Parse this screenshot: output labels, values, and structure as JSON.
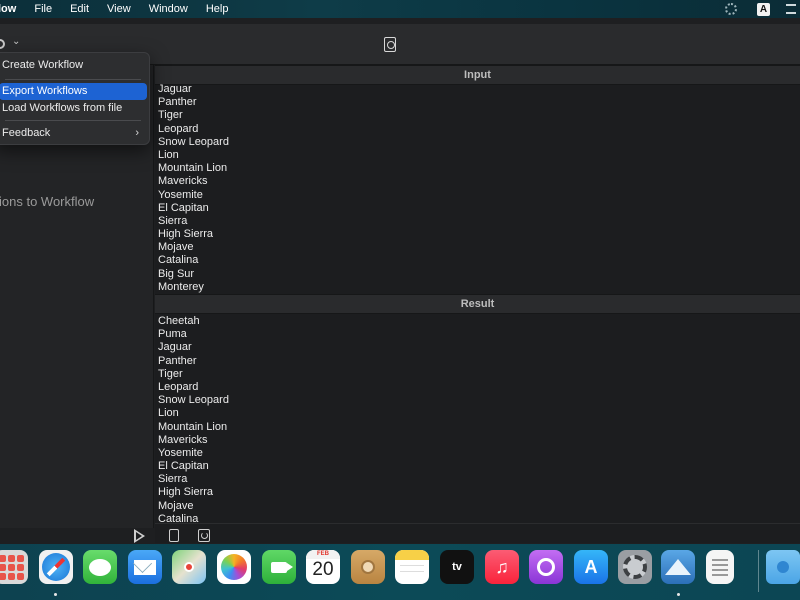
{
  "menubar": {
    "app_name": "low",
    "items": [
      "File",
      "Edit",
      "View",
      "Window",
      "Help"
    ],
    "input_indicator": "A"
  },
  "menu": {
    "items": [
      {
        "label": "Create Workflow"
      },
      {
        "label": "Export Workflows",
        "selected": true
      },
      {
        "label": "Load Workflows from file"
      },
      {
        "label": "Feedback",
        "has_submenu": true
      }
    ],
    "submenu_glyph": "›"
  },
  "sidebar": {
    "hint": "ions to Workflow"
  },
  "input": {
    "header": "Input",
    "items": [
      "Jaguar",
      "Panther",
      "Tiger",
      "Leopard",
      "Snow Leopard",
      "Lion",
      "Mountain Lion",
      "Mavericks",
      "Yosemite",
      "El Capitan",
      "Sierra",
      "High Sierra",
      "Mojave",
      "Catalina",
      "Big Sur",
      "Monterey"
    ]
  },
  "result": {
    "header": "Result",
    "items": [
      "Cheetah",
      "Puma",
      "Jaguar",
      "Panther",
      "Tiger",
      "Leopard",
      "Snow Leopard",
      "Lion",
      "Mountain Lion",
      "Mavericks",
      "Yosemite",
      "El Capitan",
      "Sierra",
      "High Sierra",
      "Mojave",
      "Catalina"
    ]
  },
  "toolbar": {
    "chevron": "⌄"
  },
  "dock": {
    "calendar_month": "FEB",
    "calendar_day": "20",
    "tv_label": "tv",
    "music_glyph": "♫",
    "appstore_glyph": "A"
  },
  "colors": {
    "menu_selection": "#1d63d3",
    "menubar_bg": "#0e3c48",
    "window_bg": "#1c1d1f"
  }
}
